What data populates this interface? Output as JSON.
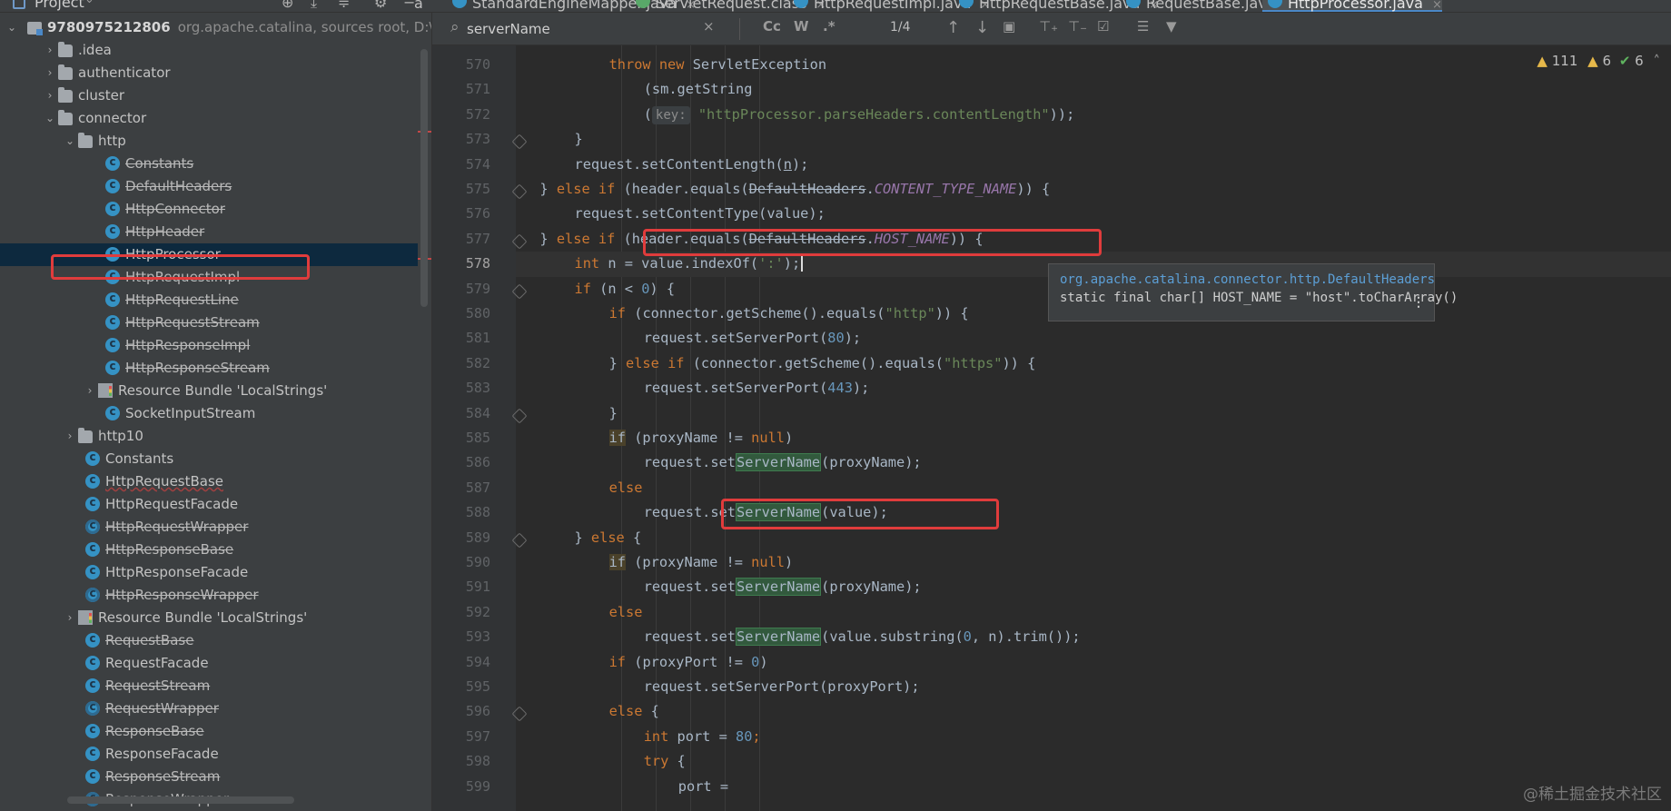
{
  "project_panel": {
    "title": "Project",
    "root": {
      "name": "9780975212806",
      "meta": "org.apache.catalina, sources root, D:\\Dov"
    },
    "items": [
      {
        "name": ".idea",
        "kind": "folder",
        "depth": 1,
        "arrow": "›",
        "strike": false
      },
      {
        "name": "authenticator",
        "kind": "folder",
        "depth": 1,
        "arrow": "›",
        "strike": false
      },
      {
        "name": "cluster",
        "kind": "folder",
        "depth": 1,
        "arrow": "›",
        "strike": false
      },
      {
        "name": "connector",
        "kind": "folder",
        "depth": 1,
        "arrow": "⌄",
        "strike": false
      },
      {
        "name": "http",
        "kind": "folder",
        "depth": 2,
        "arrow": "⌄",
        "strike": false
      },
      {
        "name": "Constants",
        "kind": "class",
        "depth": 3,
        "arrow": "",
        "strike": true
      },
      {
        "name": "DefaultHeaders",
        "kind": "class",
        "depth": 3,
        "arrow": "",
        "strike": true
      },
      {
        "name": "HttpConnector",
        "kind": "class",
        "depth": 3,
        "arrow": "",
        "strike": true
      },
      {
        "name": "HttpHeader",
        "kind": "class",
        "depth": 3,
        "arrow": "",
        "strike": true
      },
      {
        "name": "HttpProcessor",
        "kind": "class",
        "depth": 3,
        "arrow": "",
        "strike": false,
        "selected": true
      },
      {
        "name": "HttpRequestImpl",
        "kind": "class",
        "depth": 3,
        "arrow": "",
        "strike": true
      },
      {
        "name": "HttpRequestLine",
        "kind": "class",
        "depth": 3,
        "arrow": "",
        "strike": true
      },
      {
        "name": "HttpRequestStream",
        "kind": "class",
        "depth": 3,
        "arrow": "",
        "strike": true
      },
      {
        "name": "HttpResponseImpl",
        "kind": "class",
        "depth": 3,
        "arrow": "",
        "strike": true
      },
      {
        "name": "HttpResponseStream",
        "kind": "class",
        "depth": 3,
        "arrow": "",
        "strike": true
      },
      {
        "name": "Resource Bundle 'LocalStrings'",
        "kind": "bundle",
        "depth": 3,
        "arrow": "›",
        "strike": false
      },
      {
        "name": "SocketInputStream",
        "kind": "class",
        "depth": 3,
        "arrow": "",
        "strike": false
      },
      {
        "name": "http10",
        "kind": "folder",
        "depth": 2,
        "arrow": "›",
        "strike": false
      },
      {
        "name": "Constants",
        "kind": "class",
        "depth": 2,
        "arrow": "",
        "strike": false
      },
      {
        "name": "HttpRequestBase",
        "kind": "class",
        "depth": 2,
        "arrow": "",
        "strike": false,
        "underline": true
      },
      {
        "name": "HttpRequestFacade",
        "kind": "class",
        "depth": 2,
        "arrow": "",
        "strike": false
      },
      {
        "name": "HttpRequestWrapper",
        "kind": "class",
        "depth": 2,
        "arrow": "",
        "strike": true,
        "ifc": true
      },
      {
        "name": "HttpResponseBase",
        "kind": "class",
        "depth": 2,
        "arrow": "",
        "strike": true
      },
      {
        "name": "HttpResponseFacade",
        "kind": "class",
        "depth": 2,
        "arrow": "",
        "strike": false
      },
      {
        "name": "HttpResponseWrapper",
        "kind": "class",
        "depth": 2,
        "arrow": "",
        "strike": true,
        "ifc": true
      },
      {
        "name": "Resource Bundle 'LocalStrings'",
        "kind": "bundle",
        "depth": 2,
        "arrow": "›",
        "strike": false
      },
      {
        "name": "RequestBase",
        "kind": "class",
        "depth": 2,
        "arrow": "",
        "strike": true
      },
      {
        "name": "RequestFacade",
        "kind": "class",
        "depth": 2,
        "arrow": "",
        "strike": false
      },
      {
        "name": "RequestStream",
        "kind": "class",
        "depth": 2,
        "arrow": "",
        "strike": true
      },
      {
        "name": "RequestWrapper",
        "kind": "class",
        "depth": 2,
        "arrow": "",
        "strike": true,
        "ifc": true
      },
      {
        "name": "ResponseBase",
        "kind": "class",
        "depth": 2,
        "arrow": "",
        "strike": true
      },
      {
        "name": "ResponseFacade",
        "kind": "class",
        "depth": 2,
        "arrow": "",
        "strike": false
      },
      {
        "name": "ResponseStream",
        "kind": "class",
        "depth": 2,
        "arrow": "",
        "strike": true
      },
      {
        "name": "ResponseWrapper",
        "kind": "class",
        "depth": 2,
        "arrow": "",
        "strike": true,
        "ifc": true
      }
    ]
  },
  "tabs": [
    {
      "label": "a",
      "icon": "none",
      "active": false
    },
    {
      "label": "StandardEngineMapper.java",
      "icon": "class",
      "active": false
    },
    {
      "label": "ServletRequest.class",
      "icon": "compiled",
      "active": false
    },
    {
      "label": "HttpRequestImpl.java",
      "icon": "class",
      "active": false
    },
    {
      "label": "HttpRequestBase.java",
      "icon": "class",
      "active": false,
      "error": true
    },
    {
      "label": "RequestBase.java",
      "icon": "class",
      "active": false
    },
    {
      "label": "HttpProcessor.java",
      "icon": "class",
      "active": true
    }
  ],
  "search": {
    "query": "serverName",
    "clear": "×",
    "case_label": "Cc",
    "word_label": "W",
    "regex_label": ".*",
    "count": "1/4",
    "icons": [
      "up-arrow-icon",
      "down-arrow-icon",
      "select-all-icon",
      "add-occurrence-icon",
      "remove-occurrence-icon",
      "toggle-occurrence-icon",
      "multiline-icon",
      "filter-icon"
    ]
  },
  "problems": {
    "warnings": "111",
    "weak": "6",
    "ok": "6"
  },
  "code": {
    "current_line": "578",
    "lines": [
      {
        "n": "570",
        "indent": 6,
        "tokens": [
          [
            "kw",
            "throw new "
          ],
          [
            "",
            "ServletException"
          ]
        ]
      },
      {
        "n": "571",
        "indent": 7,
        "tokens": [
          [
            "",
            "(sm.getString"
          ]
        ]
      },
      {
        "n": "572",
        "indent": 7,
        "tokens": [
          [
            "",
            "("
          ],
          [
            "hint",
            "key:"
          ],
          [
            "",
            " "
          ],
          [
            "str",
            "\"httpProcessor.parseHeaders.contentLength\""
          ],
          [
            "",
            "));"
          ]
        ]
      },
      {
        "n": "573",
        "indent": 5,
        "tokens": [
          [
            "",
            "}"
          ]
        ]
      },
      {
        "n": "574",
        "indent": 5,
        "tokens": [
          [
            "",
            "request.setContentLength("
          ],
          [
            "undl",
            "n"
          ],
          [
            "",
            ");"
          ]
        ]
      },
      {
        "n": "575",
        "indent": 4,
        "tokens": [
          [
            "",
            "} "
          ],
          [
            "kw",
            "else if "
          ],
          [
            "",
            "(header.equals("
          ],
          [
            "strike",
            "DefaultHeaders"
          ],
          [
            "",
            "."
          ],
          [
            "cst",
            "CONTENT_TYPE_NAME"
          ],
          [
            "",
            ")) {"
          ]
        ]
      },
      {
        "n": "576",
        "indent": 5,
        "tokens": [
          [
            "",
            "request.setContentType(value);"
          ]
        ]
      },
      {
        "n": "577",
        "indent": 4,
        "tokens": [
          [
            "",
            "} "
          ],
          [
            "kw",
            "else if "
          ],
          [
            "",
            "(header.equals("
          ],
          [
            "strike",
            "DefaultHeaders"
          ],
          [
            "",
            "."
          ],
          [
            "cst",
            "HOST_NAME"
          ],
          [
            "",
            ")) {"
          ]
        ]
      },
      {
        "n": "578",
        "indent": 5,
        "tokens": [
          [
            "kw",
            "int "
          ],
          [
            "",
            "n = value.indexOf("
          ],
          [
            "str",
            "':'"
          ],
          [
            "",
            ");"
          ]
        ]
      },
      {
        "n": "579",
        "indent": 5,
        "tokens": [
          [
            "kw",
            "if "
          ],
          [
            "",
            "(n < "
          ],
          [
            "num",
            "0"
          ],
          [
            "",
            ") {"
          ]
        ]
      },
      {
        "n": "580",
        "indent": 6,
        "tokens": [
          [
            "kw",
            "if "
          ],
          [
            "",
            "(connector.getScheme().equals("
          ],
          [
            "str",
            "\"http\""
          ],
          [
            "",
            ")) {"
          ]
        ]
      },
      {
        "n": "581",
        "indent": 7,
        "tokens": [
          [
            "",
            "request.setServerPort("
          ],
          [
            "num",
            "80"
          ],
          [
            "",
            ");"
          ]
        ]
      },
      {
        "n": "582",
        "indent": 6,
        "tokens": [
          [
            "",
            "} "
          ],
          [
            "kw",
            "else if "
          ],
          [
            "",
            "(connector.getScheme().equals("
          ],
          [
            "str",
            "\"https\""
          ],
          [
            "",
            ")) {"
          ]
        ]
      },
      {
        "n": "583",
        "indent": 7,
        "tokens": [
          [
            "",
            "request.setServerPort("
          ],
          [
            "num",
            "443"
          ],
          [
            "",
            ");"
          ]
        ]
      },
      {
        "n": "584",
        "indent": 6,
        "tokens": [
          [
            "",
            "}"
          ]
        ]
      },
      {
        "n": "585",
        "indent": 6,
        "tokens": [
          [
            "ifbg",
            "if"
          ],
          [
            "",
            " (proxyName != "
          ],
          [
            "kw",
            "null"
          ],
          [
            "",
            ")"
          ]
        ]
      },
      {
        "n": "586",
        "indent": 7,
        "tokens": [
          [
            "",
            "request.set"
          ],
          [
            "match",
            "ServerName"
          ],
          [
            "",
            "(proxyName);"
          ]
        ]
      },
      {
        "n": "587",
        "indent": 6,
        "tokens": [
          [
            "kw",
            "else"
          ]
        ]
      },
      {
        "n": "588",
        "indent": 7,
        "tokens": [
          [
            "",
            "request.set"
          ],
          [
            "match",
            "ServerName"
          ],
          [
            "",
            "(value);"
          ]
        ]
      },
      {
        "n": "589",
        "indent": 5,
        "tokens": [
          [
            "",
            "} "
          ],
          [
            "kw",
            "else "
          ],
          [
            "",
            "{"
          ]
        ]
      },
      {
        "n": "590",
        "indent": 6,
        "tokens": [
          [
            "ifbg",
            "if"
          ],
          [
            "",
            " (proxyName != "
          ],
          [
            "kw",
            "null"
          ],
          [
            "",
            ")"
          ]
        ]
      },
      {
        "n": "591",
        "indent": 7,
        "tokens": [
          [
            "",
            "request.set"
          ],
          [
            "match",
            "ServerName"
          ],
          [
            "",
            "(proxyName);"
          ]
        ]
      },
      {
        "n": "592",
        "indent": 6,
        "tokens": [
          [
            "kw",
            "else"
          ]
        ]
      },
      {
        "n": "593",
        "indent": 7,
        "tokens": [
          [
            "",
            "request.set"
          ],
          [
            "match",
            "ServerName"
          ],
          [
            "",
            "(value.substring("
          ],
          [
            "num",
            "0"
          ],
          [
            "",
            ", n).trim());"
          ]
        ]
      },
      {
        "n": "594",
        "indent": 6,
        "tokens": [
          [
            "kw",
            "if "
          ],
          [
            "",
            "(proxyPort != "
          ],
          [
            "num",
            "0"
          ],
          [
            "",
            ")"
          ]
        ]
      },
      {
        "n": "595",
        "indent": 7,
        "tokens": [
          [
            "",
            "request.setServerPort(proxyPort);"
          ]
        ]
      },
      {
        "n": "596",
        "indent": 6,
        "tokens": [
          [
            "kw",
            "else "
          ],
          [
            "",
            "{"
          ]
        ]
      },
      {
        "n": "597",
        "indent": 7,
        "tokens": [
          [
            "kw",
            "int "
          ],
          [
            "",
            "port = "
          ],
          [
            "num",
            "80"
          ],
          [
            "kw",
            ";"
          ]
        ]
      },
      {
        "n": "598",
        "indent": 7,
        "tokens": [
          [
            "kw",
            "try "
          ],
          [
            "",
            "{"
          ]
        ]
      },
      {
        "n": "599",
        "indent": 8,
        "tokens": [
          [
            "",
            "port ="
          ]
        ]
      }
    ]
  },
  "tooltip": {
    "path": "org.apache.catalina.connector.http.DefaultHeaders",
    "decl": "static final char[] HOST_NAME = \"host\".toCharArray()",
    "more": "⋮"
  },
  "watermark": "@稀土掘金技术社区",
  "colors": {
    "highlight_red": "#e03c3c",
    "keyword": "#cc7832",
    "string": "#6a8759",
    "number": "#6897bb",
    "constant": "#9876aa",
    "match": "#32593d"
  }
}
